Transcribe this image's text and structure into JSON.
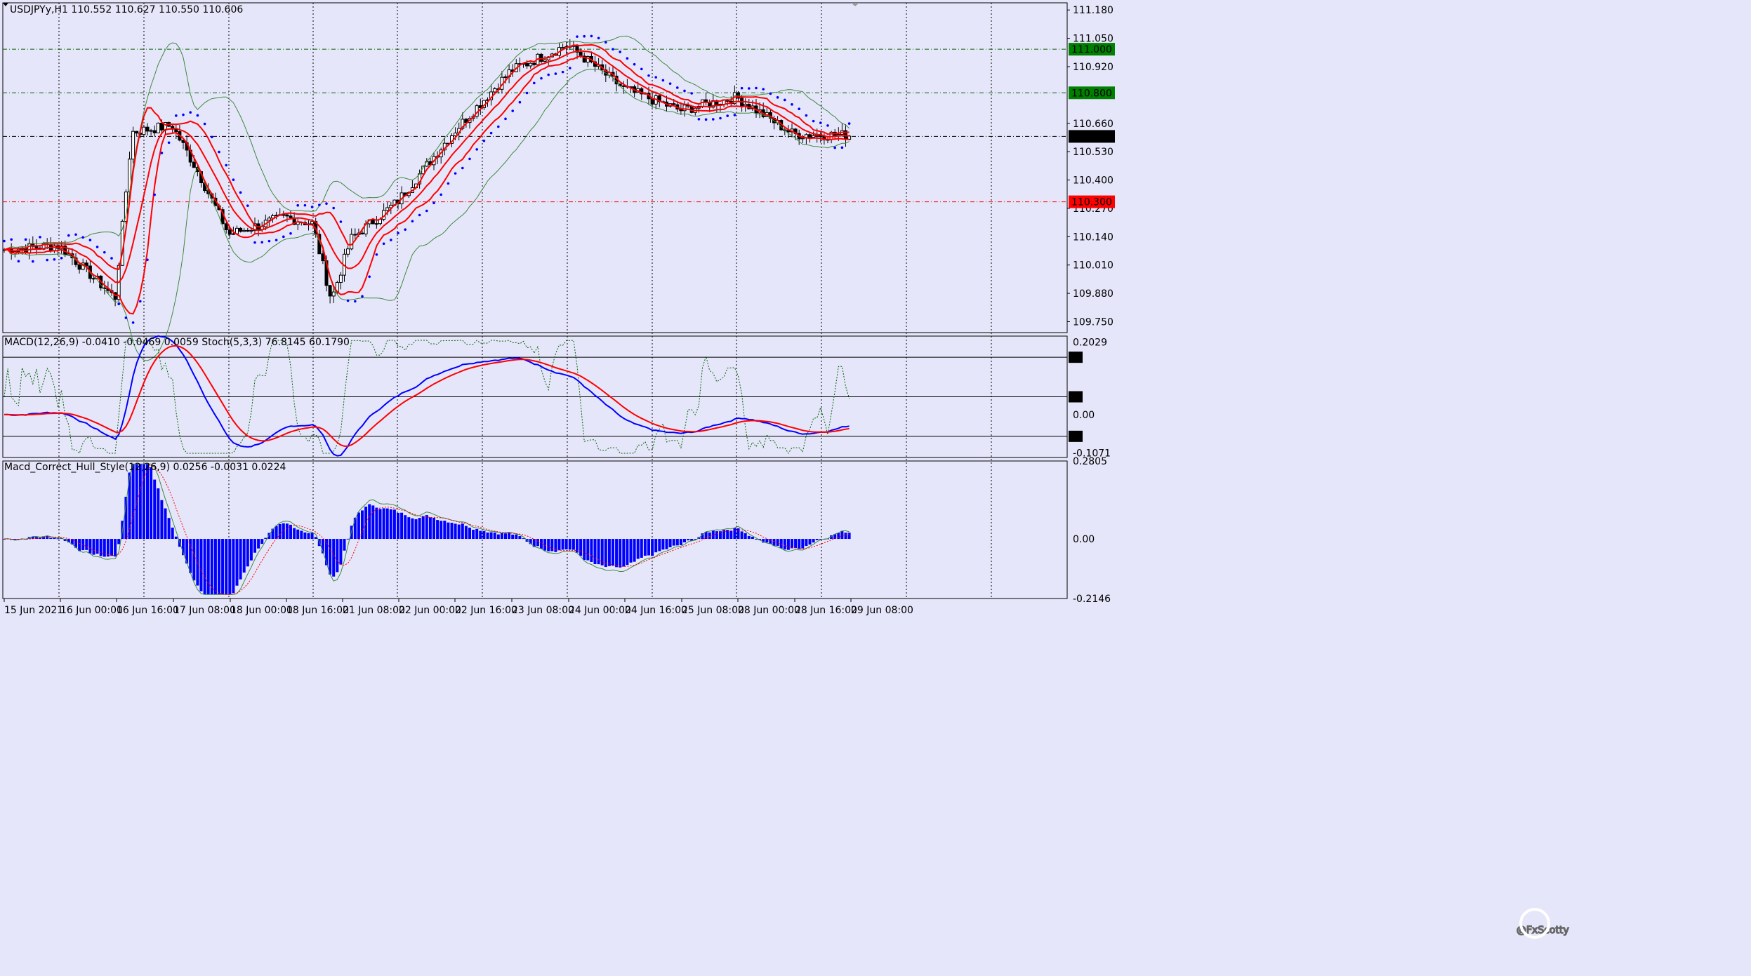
{
  "app": {
    "symbol_header": "USDJPYy,H1  110.552 110.627 110.550 110.606",
    "watermark": "@FxScotty"
  },
  "colors": {
    "background": "#e6e6fa",
    "grid": "#000000",
    "candle_bull": "#ffffff",
    "candle_bear": "#000000",
    "ma_red": "#ff0000",
    "band_green": "#3c8a3c",
    "psar_blue": "#0000ff",
    "macd_blue": "#0000ff",
    "macd_signal_red": "#ff0000",
    "stoch_green": "#006400",
    "hist_blue": "#0000ff",
    "level_green_bg": "#008000",
    "level_red_bg": "#ff0000",
    "level_black_bg": "#000000"
  },
  "main_panel": {
    "price_ticks": [
      "111.180",
      "111.050",
      "110.920",
      "110.660",
      "110.530",
      "110.400",
      "110.270",
      "110.140",
      "110.010",
      "109.880",
      "109.750"
    ],
    "levels": [
      {
        "value": "111.000",
        "color": "green"
      },
      {
        "value": "110.800",
        "color": "green"
      },
      {
        "value": "110.600",
        "color": "black"
      },
      {
        "value": "110.300",
        "color": "red"
      }
    ]
  },
  "macd_panel": {
    "header": "MACD(12,26,9) -0.0410 -0.0469 0.0059  Stoch(5,3,3) 76.8145 60.1790",
    "value_ticks": [
      "0.2029",
      "0.00",
      "-0.1071"
    ],
    "stoch_levels": [
      "85",
      "50",
      "15"
    ]
  },
  "hull_panel": {
    "header": "Macd_Correct_Hull_Style(12,26,9) 0.0256 -0.0031 0.0224",
    "value_ticks": [
      "0.2805",
      "0.00",
      "-0.2146"
    ]
  },
  "time_axis": {
    "labels": [
      "15 Jun 2021",
      "16 Jun 00:00",
      "16 Jun 16:00",
      "17 Jun 08:00",
      "18 Jun 00:00",
      "18 Jun 16:00",
      "21 Jun 08:00",
      "22 Jun 00:00",
      "22 Jun 16:00",
      "23 Jun 08:00",
      "24 Jun 00:00",
      "24 Jun 16:00",
      "25 Jun 08:00",
      "28 Jun 00:00",
      "28 Jun 16:00",
      "29 Jun 08:00"
    ]
  },
  "chart_data": [
    {
      "type": "candlestick",
      "title": "USDJPYy,H1",
      "ylim": [
        109.7,
        111.2
      ],
      "close_path": [
        [
          "15 Jun 2021",
          110.08
        ],
        [
          "16 Jun 00:00",
          110.1
        ],
        [
          "16 Jun 16:00",
          109.86
        ],
        [
          "16 Jun 16:00",
          110.62
        ],
        [
          "17 Jun 08:00",
          110.65
        ],
        [
          "17 Jun 08:00",
          110.45
        ],
        [
          "18 Jun 00:00",
          110.15
        ],
        [
          "18 Jun 16:00",
          110.23
        ],
        [
          "18 Jun 16:00",
          110.2
        ],
        [
          "21 Jun 08:00",
          109.85
        ],
        [
          "21 Jun 08:00",
          110.13
        ],
        [
          "22 Jun 00:00",
          110.3
        ],
        [
          "22 Jun 16:00",
          110.62
        ],
        [
          "23 Jun 08:00",
          110.9
        ],
        [
          "24 Jun 00:00",
          111.02
        ],
        [
          "24 Jun 16:00",
          110.82
        ],
        [
          "25 Jun 08:00",
          110.72
        ],
        [
          "28 Jun 00:00",
          110.78
        ],
        [
          "28 Jun 16:00",
          110.61
        ],
        [
          "29 Jun 08:00",
          110.606
        ]
      ],
      "last": {
        "open": 110.552,
        "high": 110.627,
        "low": 110.55,
        "close": 110.606
      }
    },
    {
      "type": "line",
      "title": "MACD(12,26,9)",
      "series": [
        {
          "name": "MACD",
          "last": -0.041
        },
        {
          "name": "Signal",
          "last": -0.0469
        }
      ],
      "stoch": {
        "main": 76.8145,
        "signal": 60.179
      },
      "ylim": [
        -0.1071,
        0.2029
      ]
    },
    {
      "type": "bar",
      "title": "Macd_Correct_Hull_Style(12,26,9)",
      "values_last": [
        0.0256,
        -0.0031,
        0.0224
      ],
      "ylim": [
        -0.2146,
        0.2805
      ]
    }
  ]
}
